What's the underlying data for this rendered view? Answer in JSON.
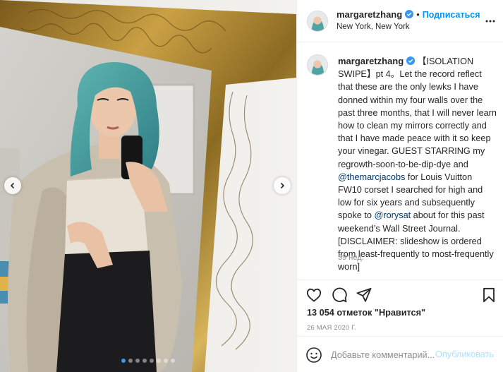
{
  "post": {
    "username": "margaretzhang",
    "follow_label": "Подписаться",
    "separator": "•",
    "location": "New York, New York",
    "caption_head": "【ISOLATION SWIPE】pt 4。Let the record reflect that these are the only lewks I have donned within my four walls over the past three months, that I will never learn how to clean my mirrors correctly and that I have made peace with it so keep your vinegar. GUEST STARRING my regrowth-soon-to-be-dip-dye and ",
    "mention_1": "@themarcjacobs",
    "caption_mid": " for Louis Vuitton FW10 corset I searched for high and low for six years and subsequently spoke to ",
    "mention_2": "@rorysat",
    "caption_tail": " about for this past weekend’s Wall Street Journal. [DISCLAIMER: slideshow is ordered from least-frequently to most-frequently worn]",
    "age": "39 нед.",
    "likes": "13 054 отметок \"Нравится\"",
    "date": "26 МАЯ 2020 Г."
  },
  "comment": {
    "placeholder": "Добавьте комментарий...",
    "publish_label": "Опубликовать"
  },
  "carousel": {
    "total_slides": 8,
    "active_index": 0
  },
  "icons": {
    "verified": "verified-badge-icon",
    "more": "more-options-icon",
    "like": "heart-icon",
    "comment": "comment-icon",
    "share": "send-icon",
    "save": "bookmark-icon",
    "emoji": "emoji-icon",
    "prev": "chevron-left-icon",
    "next": "chevron-right-icon"
  },
  "colors": {
    "accent": "#0095f6",
    "link": "#00376b",
    "muted": "#8e8e8e",
    "publish_disabled": "#b2dffc",
    "carousel_active": "#3897f0"
  }
}
